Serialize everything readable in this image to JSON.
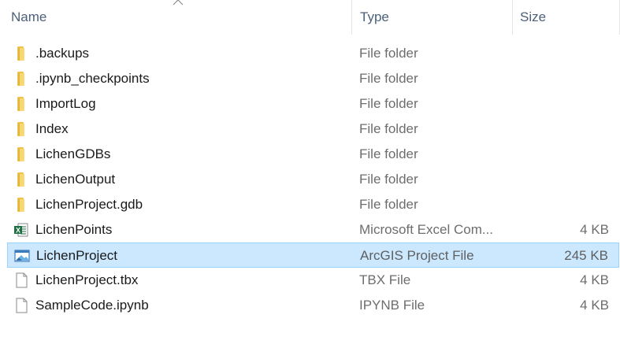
{
  "columns": {
    "name": "Name",
    "type": "Type",
    "size": "Size"
  },
  "files": [
    {
      "name": ".backups",
      "type": "File folder",
      "size": "",
      "icon": "folder-icon"
    },
    {
      "name": ".ipynb_checkpoints",
      "type": "File folder",
      "size": "",
      "icon": "folder-icon"
    },
    {
      "name": "ImportLog",
      "type": "File folder",
      "size": "",
      "icon": "folder-icon"
    },
    {
      "name": "Index",
      "type": "File folder",
      "size": "",
      "icon": "folder-icon"
    },
    {
      "name": "LichenGDBs",
      "type": "File folder",
      "size": "",
      "icon": "folder-icon"
    },
    {
      "name": "LichenOutput",
      "type": "File folder",
      "size": "",
      "icon": "folder-icon"
    },
    {
      "name": "LichenProject.gdb",
      "type": "File folder",
      "size": "",
      "icon": "folder-icon"
    },
    {
      "name": "LichenPoints",
      "type": "Microsoft Excel Com...",
      "size": "4 KB",
      "icon": "excel-file-icon"
    },
    {
      "name": "LichenProject",
      "type": "ArcGIS Project File",
      "size": "245 KB",
      "icon": "arcgis-project-icon",
      "selected": true
    },
    {
      "name": "LichenProject.tbx",
      "type": "TBX File",
      "size": "4 KB",
      "icon": "blank-file-icon"
    },
    {
      "name": "SampleCode.ipynb",
      "type": "IPYNB File",
      "size": "4 KB",
      "icon": "blank-file-icon"
    }
  ],
  "colors": {
    "selection_bg": "#cce8ff",
    "selection_border": "#99d1ff",
    "header_text": "#4c607a",
    "folder": "#f8d775",
    "excel": "#1d6f42"
  },
  "sort": {
    "column": "name",
    "direction": "ascending",
    "icon": "sort-up-icon"
  }
}
